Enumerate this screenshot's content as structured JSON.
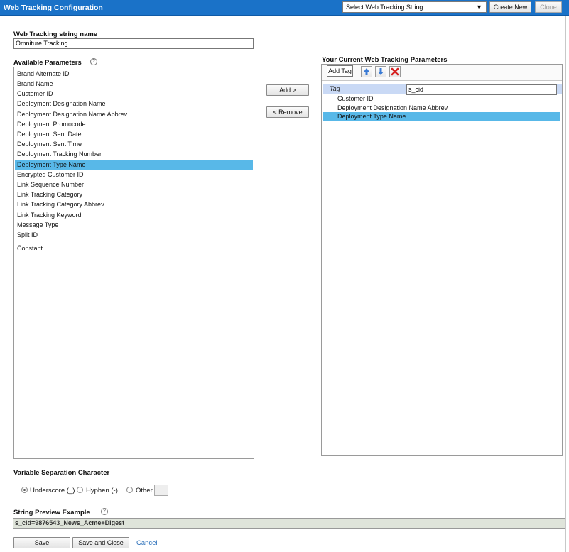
{
  "header": {
    "title": "Web Tracking Configuration",
    "select_value": "Select Web Tracking String",
    "create_new_label": "Create New",
    "clone_label": "Clone"
  },
  "name_field": {
    "label": "Web Tracking string name",
    "value": "Omniture Tracking"
  },
  "available": {
    "label": "Available Parameters",
    "items": [
      "Brand Alternate ID",
      "Brand Name",
      "Customer ID",
      "Deployment Designation Name",
      "Deployment Designation Name Abbrev",
      "Deployment Promocode",
      "Deployment Sent Date",
      "Deployment Sent Time",
      "Deployment Tracking Number",
      "Deployment Type Name",
      "Encrypted Customer ID",
      "Link Sequence Number",
      "Link Tracking Category",
      "Link Tracking Category Abbrev",
      "Link Tracking Keyword",
      "Message Type",
      "Split ID",
      "Constant"
    ],
    "selected": "Deployment Type Name"
  },
  "transfer": {
    "add_label": "Add  >",
    "remove_label": "<  Remove"
  },
  "current": {
    "label": "Your Current Web Tracking Parameters",
    "add_tag_label": "Add Tag",
    "tag_label": "Tag",
    "tag_value": "s_cid",
    "items": [
      "Customer ID",
      "Deployment Designation Name Abbrev",
      "Deployment Type Name"
    ],
    "selected": "Deployment Type Name"
  },
  "separator": {
    "label": "Variable Separation Character",
    "options": [
      "Underscore (_)",
      "Hyphen (-)",
      "Other"
    ],
    "selected": "Underscore (_)"
  },
  "preview": {
    "label": "String Preview Example",
    "value": "s_cid=9876543_News_Acme+Digest"
  },
  "footer": {
    "save_label": "Save",
    "save_close_label": "Save and Close",
    "cancel_label": "Cancel"
  },
  "icons": {
    "up": "arrow-up-icon",
    "down": "arrow-down-icon",
    "delete": "delete-x-icon",
    "help": "help-circle-icon"
  },
  "colors": {
    "titlebar": "#1a72c8",
    "selection": "#58b8e8",
    "tag_row": "#c9d9f5"
  }
}
